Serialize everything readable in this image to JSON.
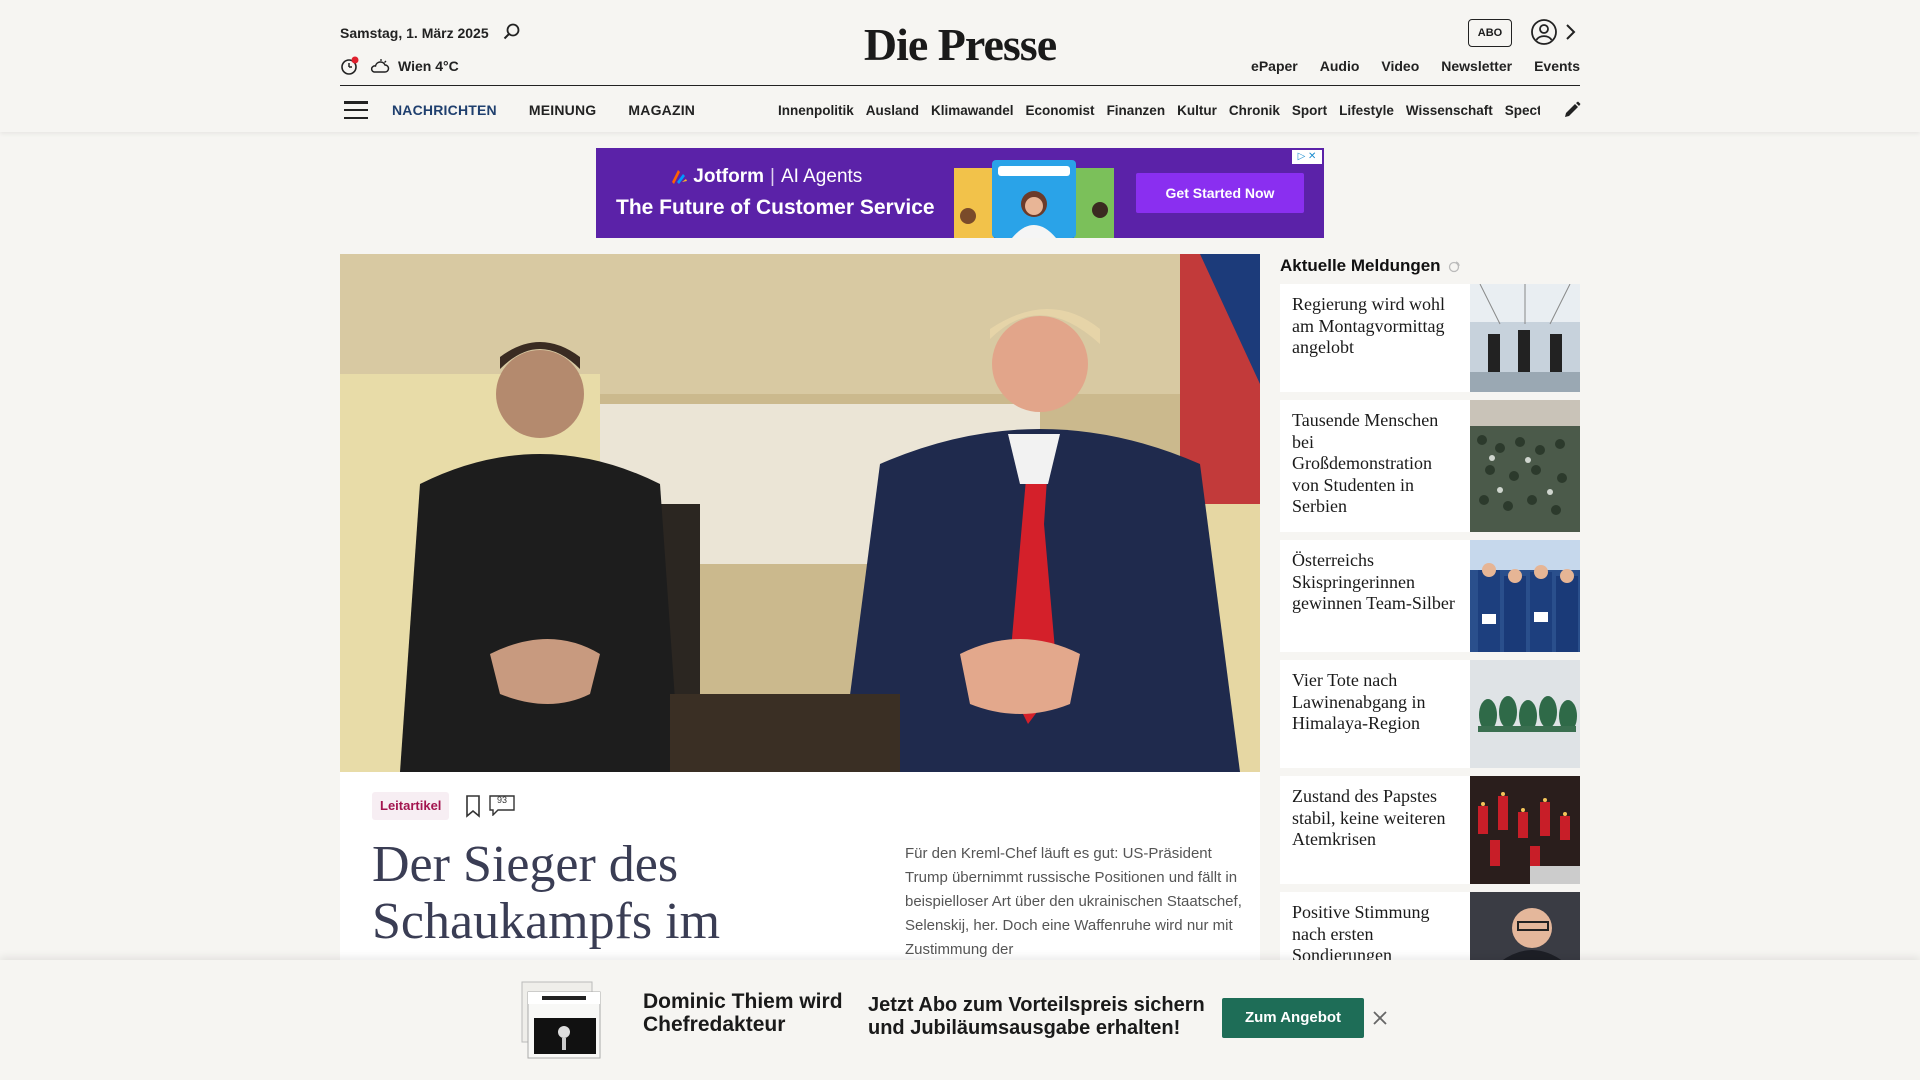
{
  "header": {
    "date": "Samstag, 1. März 2025",
    "weather": "Wien 4°C",
    "logo": "Die Presse",
    "abo_label": "ABO",
    "tools": [
      "ePaper",
      "Audio",
      "Video",
      "Newsletter",
      "Events"
    ],
    "nav_main": [
      "NACHRICHTEN",
      "MEINUNG",
      "MAGAZIN"
    ],
    "ressorts": [
      "Innenpolitik",
      "Ausland",
      "Klimawandel",
      "Economist",
      "Finanzen",
      "Kultur",
      "Chronik",
      "Sport",
      "Lifestyle",
      "Wissenschaft",
      "Spectrum"
    ]
  },
  "ad": {
    "brand": "Jotform",
    "product": "AI Agents",
    "title": "The Future of Customer Service",
    "cta": "Get Started Now"
  },
  "lead": {
    "tag": "Leitartikel",
    "comment_count": "93",
    "headline": "Der Sieger des Schaukampfs im",
    "teaser": "Für den Kreml-Chef läuft es gut: US-Präsident Trump übernimmt russische Positionen und fällt in beispielloser Art über den ukrainischen Staatschef, Selenskij, her. Doch eine Waffenruhe wird nur mit Zustimmung der"
  },
  "aside": {
    "title": "Aktuelle Meldungen",
    "items": [
      {
        "text": "Regierung wird wohl am Montagvormittag angelobt"
      },
      {
        "text": "Tausende Menschen bei Großdemonstration von Studenten in Serbien"
      },
      {
        "text": "Österreichs Skispringerinnen gewinnen Team-Silber"
      },
      {
        "text": "Vier Tote nach Lawinenabgang in Himalaya-Region"
      },
      {
        "text": "Zustand des Papstes stabil, keine weiteren Atemkrisen"
      },
      {
        "text": "Positive Stimmung nach ersten Sondierungen"
      }
    ]
  },
  "banner": {
    "title": "Dominic Thiem wird Chefredakteur",
    "text": "Jetzt Abo zum Vorteilspreis sichern und Jubiläumsausgabe erhalten!",
    "button": "Zum Angebot"
  },
  "colors": {
    "nav_active": "#1f3f6e",
    "tag": "#a3154f",
    "banner_button": "#1e6d57",
    "ad_bg": "#5b22a8"
  }
}
